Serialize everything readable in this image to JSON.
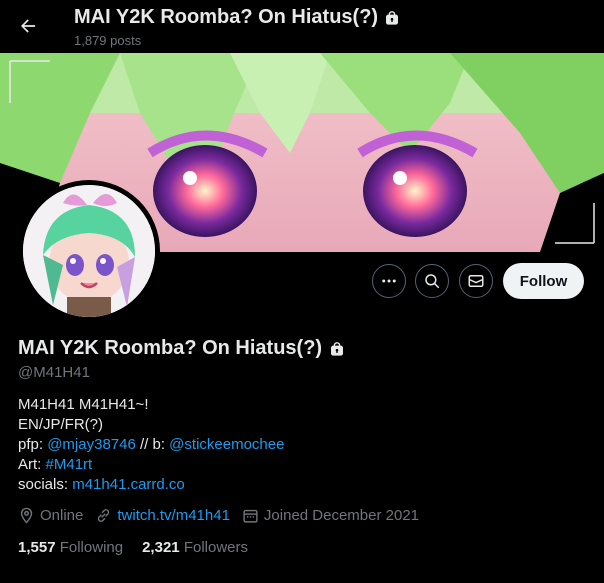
{
  "header": {
    "title": "MAI Y2K Roomba? On Hiatus(?)",
    "posts": "1,879 posts"
  },
  "actions": {
    "follow_label": "Follow"
  },
  "profile": {
    "name": "MAI Y2K Roomba? On Hiatus(?)",
    "handle": "@M41H41"
  },
  "bio": {
    "line1": "M41H41 M41H41~!",
    "line2": "EN/JP/FR(?)",
    "pfp_label": "pfp:",
    "pfp_link": "@mjay38746",
    "b_sep": "// b:",
    "b_link": "@stickeemochee",
    "art_label": "Art:",
    "art_link": "#M41rt",
    "socials_label": "socials:",
    "socials_link": "m41h41.carrd.co"
  },
  "meta": {
    "location": "Online",
    "website": "twitch.tv/m41h41",
    "joined": "Joined December 2021"
  },
  "stats": {
    "following_count": "1,557",
    "following_label": "Following",
    "followers_count": "2,321",
    "followers_label": "Followers"
  },
  "colors": {
    "accent": "#1d9bf0",
    "muted": "#71767b",
    "text": "#e7e9ea"
  }
}
